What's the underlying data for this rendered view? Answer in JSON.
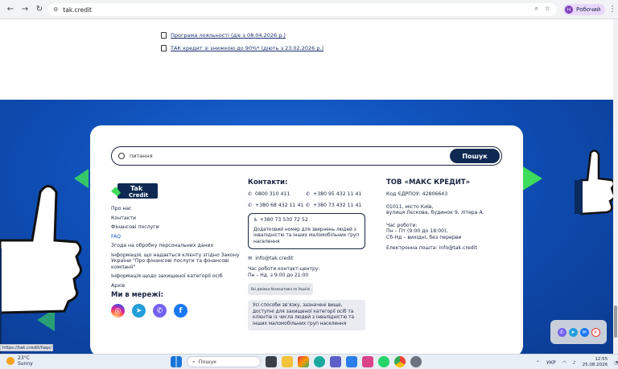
{
  "browser": {
    "url": "tak.credit",
    "profile_name": "Робочий",
    "profile_initial": "Н"
  },
  "documents": [
    {
      "label": "Програма лояльності (діє з 08.04.2026 р.)"
    },
    {
      "label": "ТАК кредит зі знижкою до 90%* (діють з 23.02.2026 р.)"
    }
  ],
  "search": {
    "query": "питання",
    "button_label": "Пошук"
  },
  "logo": {
    "text_top": "Tak",
    "text_bottom": "Credit"
  },
  "footer_links": [
    "Про нас",
    "Контакти",
    "Фінансові послуги",
    "FAQ",
    "Згода на обробку персональних даних",
    "Інформація, що надається клієнту згідно Закону України \"Про фінансові послуги та фінансові компанії\"",
    "Інформація щодо захищеної категорії осіб",
    "Архів"
  ],
  "socials": {
    "title": "Ми в мережі:",
    "colors": {
      "instagram": "#d6249f",
      "telegram": "#229ed9",
      "viber": "#7360f2",
      "facebook": "#1877f2"
    }
  },
  "contacts": {
    "title": "Контакти:",
    "phones": [
      "0800 310 411",
      "+380 95 432 11 41",
      "+380 68 432 11 41",
      "+380 73 432 11 41"
    ],
    "special_phone": "+380 73 530 72 52",
    "special_desc": "Додатковий номер для звернень людей з інвалідністю та інших маломобільних груп населення",
    "email": "info@tak.credit",
    "hours_title": "Час роботи контакт-центру:",
    "hours": "Пн – Нд. з 9:00 до 21:00",
    "free_note": "Всі дзвінки безкоштовні по Україні",
    "all_ways": "Усі способи зв’язку, зазначені вище, доступні для захищеної категорії осіб та клієнтів із числа людей з інвалідністю та інших маломобільних груп населення"
  },
  "company": {
    "title": "ТОВ «МАКС КРЕДИТ»",
    "edrpou": "Код ЄДРПОУ: 42806643",
    "address_1": "01011, місто Київ,",
    "address_2": "вулиця Лєскова, будинок 9, літера А.",
    "hours_label": "Час роботи:",
    "hours_1": "Пн – Пт (9:00 до 18:00),",
    "hours_2": "Сб-Нд – вихідні, без перерви",
    "email": "Електронна пошта: info@tak.credit"
  },
  "status_url": "https://tak.credit/faqs/",
  "taskbar": {
    "temp": "23°C",
    "weather": "Sunny",
    "search_label": "Пошук",
    "lang": "УКР",
    "time": "12:55",
    "date": "25.08.2026"
  },
  "colors": {
    "brand_dark": "#0e2a52",
    "blue_bg": "#0f4fb7",
    "green": "#3ddc5a"
  }
}
